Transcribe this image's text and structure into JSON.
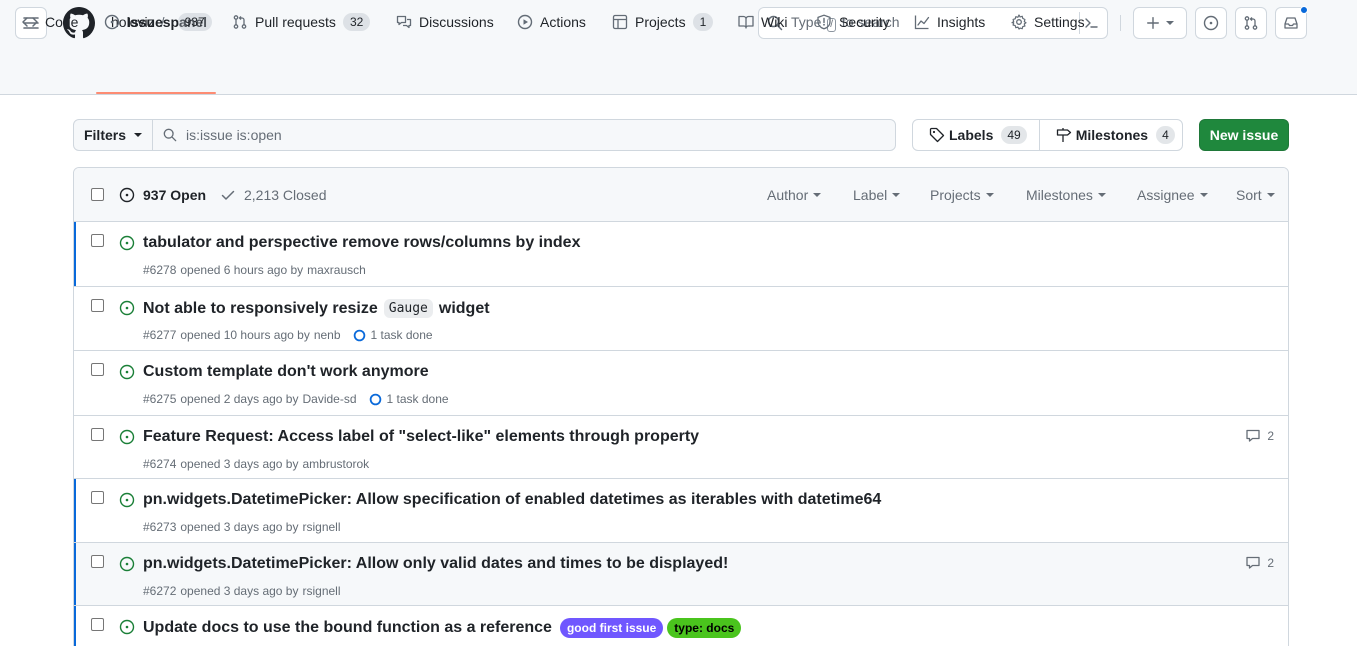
{
  "header": {
    "owner": "holoviz",
    "separator": "/",
    "repo": "panel",
    "search_prefix": "Type",
    "search_key": "/",
    "search_suffix": "to search"
  },
  "tabs": [
    {
      "label": "Code",
      "icon": "code-icon"
    },
    {
      "label": "Issues",
      "count": "937",
      "icon": "issue-opened-icon",
      "active": true
    },
    {
      "label": "Pull requests",
      "count": "32",
      "icon": "git-pull-request-icon"
    },
    {
      "label": "Discussions",
      "icon": "comment-discussion-icon"
    },
    {
      "label": "Actions",
      "icon": "play-icon"
    },
    {
      "label": "Projects",
      "count": "1",
      "icon": "table-icon"
    },
    {
      "label": "Wiki",
      "icon": "book-icon"
    },
    {
      "label": "Security",
      "icon": "shield-icon"
    },
    {
      "label": "Insights",
      "icon": "graph-icon"
    },
    {
      "label": "Settings",
      "icon": "gear-icon"
    }
  ],
  "filters": {
    "button_label": "Filters",
    "query": "is:issue is:open",
    "labels_label": "Labels",
    "labels_count": "49",
    "milestones_label": "Milestones",
    "milestones_count": "4",
    "new_issue_label": "New issue"
  },
  "list_header": {
    "open_label": "937 Open",
    "closed_label": "2,213 Closed",
    "filters": [
      "Author",
      "Label",
      "Projects",
      "Milestones",
      "Assignee",
      "Sort"
    ]
  },
  "issues": [
    {
      "title": "tabulator and perspective remove rows/columns by index",
      "number": "#6278",
      "opened": "opened 6 hours ago by",
      "author": "maxrausch"
    },
    {
      "title_pre": "Not able to responsively resize",
      "title_code": "Gauge",
      "title_post": "widget",
      "number": "#6277",
      "opened": "opened 10 hours ago by",
      "author": "nenb",
      "tasks": "1 task done"
    },
    {
      "title": "Custom template don't work anymore",
      "number": "#6275",
      "opened": "opened 2 days ago by",
      "author": "Davide-sd",
      "tasks": "1 task done"
    },
    {
      "title": "Feature Request: Access label of \"select-like\" elements through property",
      "number": "#6274",
      "opened": "opened 3 days ago by",
      "author": "ambrustorok",
      "comments": "2"
    },
    {
      "title": "pn.widgets.DatetimePicker: Allow specification of enabled datetimes as iterables with datetime64",
      "number": "#6273",
      "opened": "opened 3 days ago by",
      "author": "rsignell"
    },
    {
      "title": "pn.widgets.DatetimePicker: Allow only valid dates and times to be displayed!",
      "number": "#6272",
      "opened": "opened 3 days ago by",
      "author": "rsignell",
      "comments": "2"
    },
    {
      "title": "Update docs to use the bound function as a reference",
      "labels": [
        {
          "text": "good first issue",
          "color": "#7057ff",
          "text_color": "#ffffff"
        },
        {
          "text": "type: docs",
          "color": "#4ac41d",
          "text_color": "#000000"
        }
      ]
    }
  ],
  "colors": {
    "accent": "#0969da",
    "open_green": "#1a7f37",
    "primary_button": "#1f883d",
    "tab_underline": "#fd8c73"
  }
}
